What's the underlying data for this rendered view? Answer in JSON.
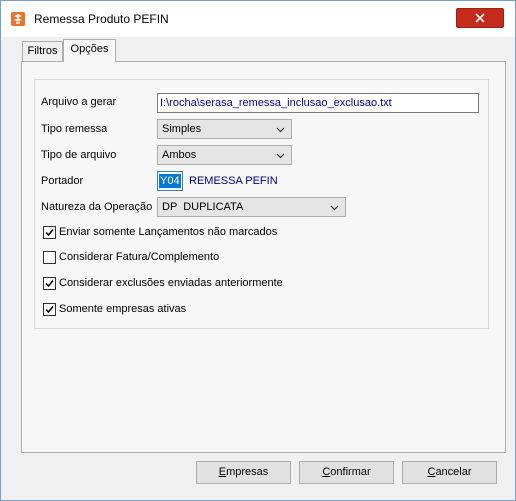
{
  "window": {
    "title": "Remessa Produto PEFIN"
  },
  "tabs": [
    {
      "label": "Filtros",
      "active": false
    },
    {
      "label": "Opções",
      "active": true
    }
  ],
  "form": {
    "arquivo_label": "Arquivo a gerar",
    "arquivo_value": "I:\\rocha\\serasa_remessa_inclusao_exclusao.txt",
    "tipo_remessa_label": "Tipo remessa",
    "tipo_remessa_value": "Simples",
    "tipo_arquivo_label": "Tipo de arquivo",
    "tipo_arquivo_value": "Ambos",
    "portador_label": "Portador",
    "portador_code": "Y04",
    "portador_desc": "REMESSA PEFIN",
    "natureza_label": "Natureza da Operação",
    "natureza_value": "DP  DUPLICATA"
  },
  "checkboxes": [
    {
      "label": "Enviar somente Lançamentos não marcados",
      "checked": true
    },
    {
      "label": "Considerar Fatura/Complemento",
      "checked": false
    },
    {
      "label": "Considerar exclusões enviadas anteriormente",
      "checked": true
    },
    {
      "label": "Somente empresas ativas",
      "checked": true
    }
  ],
  "buttons": {
    "empresas_first": "E",
    "empresas_rest": "mpresas",
    "confirmar_first": "C",
    "confirmar_rest": "onfirmar",
    "cancelar_first": "C",
    "cancelar_rest": "ancelar"
  },
  "colors": {
    "app_icon": "#e8732a",
    "close_button": "#c42b1c",
    "value_text": "#000080",
    "selection": "#0078d7"
  },
  "icons": {
    "app": "app-icon",
    "close": "close-icon",
    "dropdown": "chevron-down-icon",
    "check": "checkmark-icon"
  }
}
